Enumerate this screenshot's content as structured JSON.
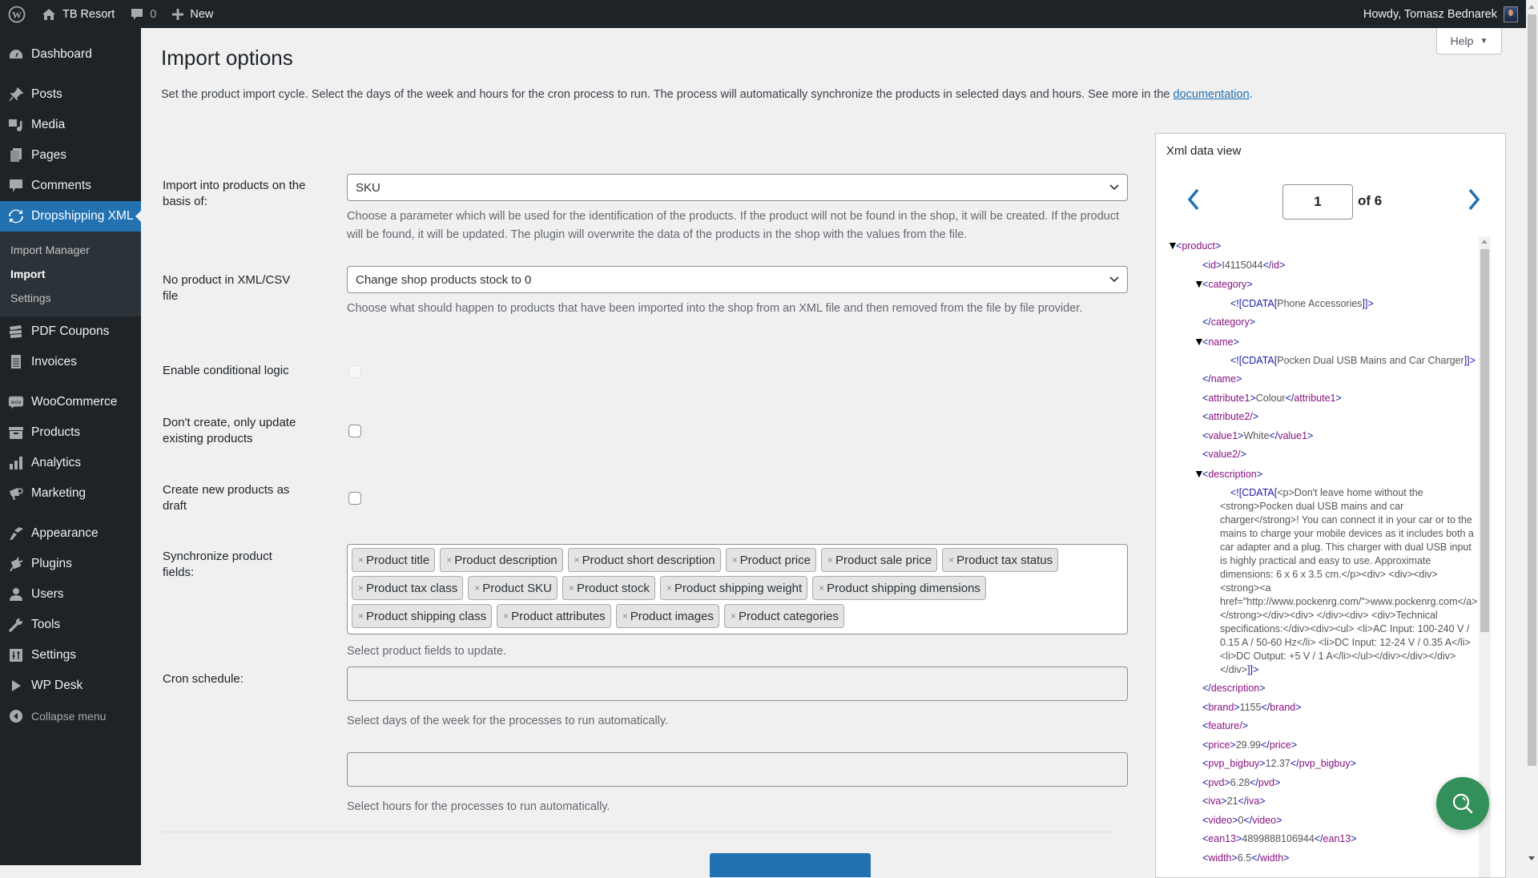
{
  "adminbar": {
    "site_name": "TB Resort",
    "comments_count": "0",
    "new_label": "New",
    "howdy": "Howdy, Tomasz Bednarek"
  },
  "sidebar": {
    "items": [
      {
        "label": "Dashboard",
        "icon": "dashboard-icon"
      },
      {
        "label": "Posts",
        "icon": "pin-icon"
      },
      {
        "label": "Media",
        "icon": "media-icon"
      },
      {
        "label": "Pages",
        "icon": "pages-icon"
      },
      {
        "label": "Comments",
        "icon": "comment-icon"
      },
      {
        "label": "Dropshipping XML",
        "icon": "sync-icon",
        "active": true
      },
      {
        "label": "PDF Coupons",
        "icon": "coupons-icon"
      },
      {
        "label": "Invoices",
        "icon": "invoice-icon"
      },
      {
        "label": "WooCommerce",
        "icon": "woo-icon"
      },
      {
        "label": "Products",
        "icon": "archive-icon"
      },
      {
        "label": "Analytics",
        "icon": "bar-chart-icon"
      },
      {
        "label": "Marketing",
        "icon": "megaphone-icon"
      },
      {
        "label": "Appearance",
        "icon": "brush-icon"
      },
      {
        "label": "Plugins",
        "icon": "plug-icon"
      },
      {
        "label": "Users",
        "icon": "user-icon"
      },
      {
        "label": "Tools",
        "icon": "wrench-icon"
      },
      {
        "label": "Settings",
        "icon": "sliders-icon"
      },
      {
        "label": "WP Desk",
        "icon": "play-icon"
      }
    ],
    "submenu": [
      "Import Manager",
      "Import",
      "Settings"
    ],
    "submenu_current": "Import",
    "collapse_label": "Collapse menu"
  },
  "header": {
    "help_label": "Help",
    "title": "Import options",
    "intro": "Set the product import cycle. Select the days of the week and hours for the cron process to run. The process will automatically synchronize the products in selected days and hours. See more in the ",
    "intro_link": "documentation",
    "intro_end": "."
  },
  "form": {
    "basis": {
      "label": "Import into products on the basis of:",
      "value": "SKU",
      "description": "Choose a parameter which will be used for the identification of the products. If the product will not be found in the shop, it will be created. If the product will be found, it will be updated. The plugin will overwrite the data of the products in the shop with the values from the file."
    },
    "no_product": {
      "label": "No product in XML/CSV file",
      "value": "Change shop products stock to 0",
      "description": "Choose what should happen to products that have been imported into the shop from an XML file and then removed from the file by file provider."
    },
    "conditional_logic": {
      "label": "Enable conditional logic",
      "checked": false,
      "disabled": true
    },
    "only_update": {
      "label": "Don't create, only update existing products",
      "checked": false
    },
    "draft": {
      "label": "Create new products as draft",
      "checked": false
    },
    "sync_fields": {
      "label": "Synchronize product fields:",
      "tags": [
        "Product title",
        "Product description",
        "Product short description",
        "Product price",
        "Product sale price",
        "Product tax status",
        "Product tax class",
        "Product SKU",
        "Product stock",
        "Product shipping weight",
        "Product shipping dimensions",
        "Product shipping class",
        "Product attributes",
        "Product images",
        "Product categories"
      ],
      "remove_glyph": "×",
      "description": "Select product fields to update."
    },
    "cron": {
      "label": "Cron schedule:",
      "days_value": "",
      "days_description": "Select days of the week for the processes to run automatically.",
      "hours_value": "",
      "hours_description": "Select hours for the processes to run automatically."
    }
  },
  "xml_view": {
    "title": "Xml data view",
    "page": "1",
    "of_label": "of 6",
    "tree": {
      "root": "product",
      "id": "I4115044",
      "category_cdata": "Phone Accessories",
      "name_cdata": "Pocken Dual USB Mains and Car Charger",
      "attribute1": "Colour",
      "value1": "White",
      "description_cdata": "<p>Don't leave home without the <strong>Pocken dual USB mains and car charger</strong>! You can connect it in your car or to the mains to charge your mobile devices as it includes both a car adapter and a plug. This charger with dual USB input is highly practical and easy to use. Approximate dimensions: 6 x 6 x 3.5 cm.</p><div> <div><div><strong><a href=\"http://www.pockenrg.com/\">www.pockenrg.com</a></strong></div><div> </div><div> <div>Technical specifications:</div><div><ul> <li>AC Input: 100-240 V / 0.15 A / 50-60 Hz</li> <li>DC Input: 12-24 V / 0.35 A</li><li>DC Output: +5 V / 1 A</li></ul></div></div></div></div>",
      "leaf_elements": [
        {
          "tag": "brand",
          "value": "1155"
        },
        {
          "tag": "feature",
          "value": null
        },
        {
          "tag": "price",
          "value": "29.99"
        },
        {
          "tag": "pvp_bigbuy",
          "value": "12.37"
        },
        {
          "tag": "pvd",
          "value": "6.28"
        },
        {
          "tag": "iva",
          "value": "21"
        },
        {
          "tag": "video",
          "value": "0"
        },
        {
          "tag": "ean13",
          "value": "4899888106944"
        },
        {
          "tag": "width",
          "value": "6.5"
        }
      ]
    }
  },
  "colors": {
    "accent": "#2271b1",
    "adminbar": "#1d2327",
    "fab": "#34905a"
  }
}
